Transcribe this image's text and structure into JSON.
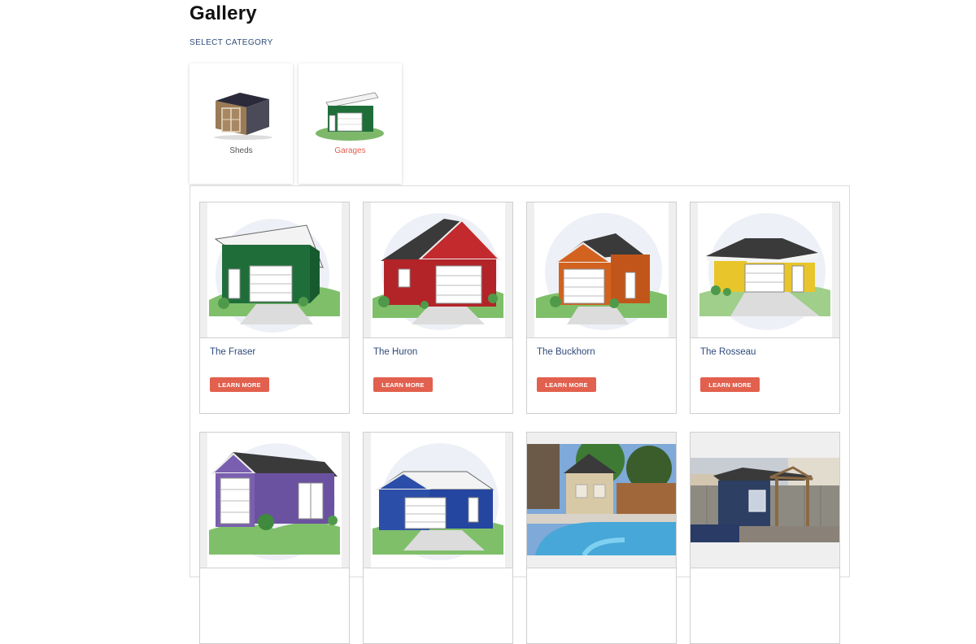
{
  "page": {
    "title": "Gallery",
    "select_label": "SELECT CATEGORY"
  },
  "categories": [
    {
      "label": "Sheds",
      "active": false,
      "icon": "shed-thumbnail"
    },
    {
      "label": "Garages",
      "active": true,
      "icon": "garage-thumbnail"
    }
  ],
  "items": [
    {
      "title": "The Fraser",
      "button": "LEARN MORE",
      "icon": "green-shed-roof-garage",
      "color": "#1f6e3a"
    },
    {
      "title": "The Huron",
      "button": "LEARN MORE",
      "icon": "red-gable-garage",
      "color": "#b32428"
    },
    {
      "title": "The Buckhorn",
      "button": "LEARN MORE",
      "icon": "orange-gable-garage",
      "color": "#d3621f"
    },
    {
      "title": "The Rosseau",
      "button": "LEARN MORE",
      "icon": "yellow-hip-roof-garage",
      "color": "#e8c62b"
    },
    {
      "title": "",
      "button": "",
      "icon": "purple-gable-garage",
      "color": "#7a5fb0"
    },
    {
      "title": "",
      "button": "",
      "icon": "blue-gable-garage",
      "color": "#2b4ea8"
    },
    {
      "title": "",
      "button": "",
      "icon": "poolside-cabana-photo",
      "color": "#c9b48a"
    },
    {
      "title": "",
      "button": "",
      "icon": "blue-shed-with-porch-photo",
      "color": "#2d3f63"
    }
  ],
  "colors": {
    "accent": "#e2604e",
    "link": "#2e4a7a",
    "active_category": "#e1604f"
  }
}
